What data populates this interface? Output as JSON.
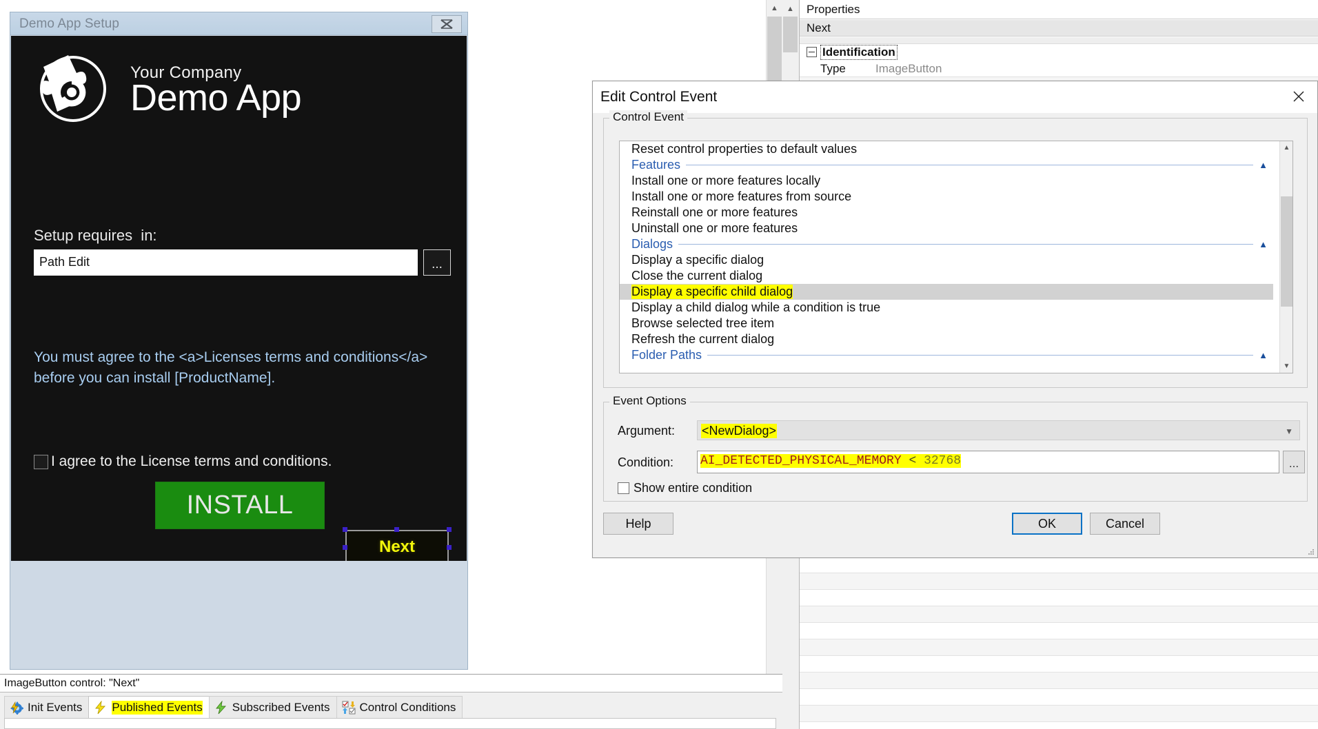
{
  "installer": {
    "title": "Demo App Setup",
    "close_icon": "close-x-icon",
    "brand_company": "Your Company",
    "brand_product": "Demo App",
    "requires_label": "Setup requires  in:",
    "path_value": "Path Edit",
    "browse_label": "...",
    "license_line1": "You must agree to the <a>Licenses terms and conditions</a>",
    "license_line2": "before you can install [ProductName].",
    "agree_label": "I agree to the License terms and conditions.",
    "install_label": "INSTALL",
    "next_label": "Next",
    "colors": {
      "background": "#121212",
      "install_green": "#1a8c10",
      "next_yellow": "#f3f70b",
      "license_blue": "#a8cdf0",
      "handle_blue": "#3a21c8"
    }
  },
  "statusbar": {
    "text": "ImageButton control: \"Next\""
  },
  "tabstrip": {
    "tabs": [
      {
        "label": "Init Events",
        "icon": "gear-lightning-icon",
        "active": false,
        "highlight": false
      },
      {
        "label": "Published Events",
        "icon": "yellow-lightning-icon",
        "active": true,
        "highlight": true
      },
      {
        "label": "Subscribed Events",
        "icon": "green-lightning-icon",
        "active": false,
        "highlight": false
      },
      {
        "label": "Control Conditions",
        "icon": "checkbox-arrows-icon",
        "active": false,
        "highlight": false
      }
    ]
  },
  "properties": {
    "panel_title": "Properties",
    "selected_object": "Next",
    "group_title": "Identification",
    "rows": [
      {
        "key": "Type",
        "value": "ImageButton"
      }
    ]
  },
  "modal": {
    "title": "Edit Control Event",
    "close_icon": "close-x-icon",
    "control_event_legend": "Control Event",
    "event_options_legend": "Event Options",
    "list": [
      {
        "kind": "item",
        "label": "Reset control properties to default values",
        "selected": false,
        "highlight": false
      },
      {
        "kind": "separator",
        "label": "Features",
        "chevron": "chevron-up-icon"
      },
      {
        "kind": "item",
        "label": "Install one or more features locally",
        "selected": false,
        "highlight": false
      },
      {
        "kind": "item",
        "label": "Install one or more features from source",
        "selected": false,
        "highlight": false
      },
      {
        "kind": "item",
        "label": "Reinstall one or more features",
        "selected": false,
        "highlight": false
      },
      {
        "kind": "item",
        "label": "Uninstall one or more features",
        "selected": false,
        "highlight": false
      },
      {
        "kind": "separator",
        "label": "Dialogs",
        "chevron": "chevron-up-icon"
      },
      {
        "kind": "item",
        "label": "Display a specific dialog",
        "selected": false,
        "highlight": false
      },
      {
        "kind": "item",
        "label": "Close the current dialog",
        "selected": false,
        "highlight": false
      },
      {
        "kind": "item",
        "label": "Display a specific child dialog",
        "selected": true,
        "highlight": true
      },
      {
        "kind": "item",
        "label": "Display a child dialog while a condition is true",
        "selected": false,
        "highlight": false
      },
      {
        "kind": "item",
        "label": "Browse selected tree item",
        "selected": false,
        "highlight": false
      },
      {
        "kind": "item",
        "label": "Refresh the current dialog",
        "selected": false,
        "highlight": false
      },
      {
        "kind": "separator",
        "label": "Folder Paths",
        "chevron": "chevron-up-icon"
      }
    ],
    "argument_label": "Argument:",
    "argument_value": "<NewDialog>",
    "condition_label": "Condition:",
    "condition_identifier": "AI_DETECTED_PHYSICAL_MEMORY",
    "condition_operator": " < ",
    "condition_number": "32768",
    "condition_browse_label": "...",
    "show_entire_condition_label": "Show entire condition",
    "help_label": "Help",
    "ok_label": "OK",
    "cancel_label": "Cancel",
    "colors": {
      "highlight_yellow": "#ffff00",
      "selection_gray": "#d2d2d2",
      "separator_blue": "#2a5db0",
      "focus_blue": "#0a72c6"
    }
  }
}
